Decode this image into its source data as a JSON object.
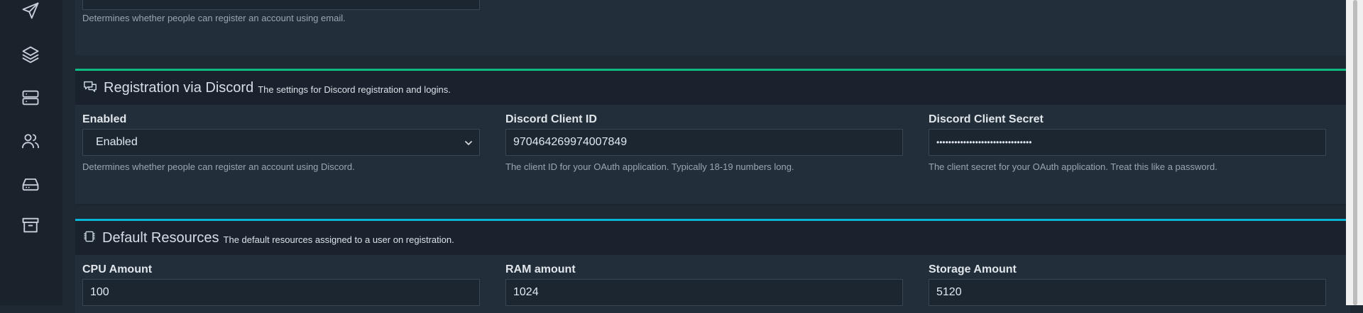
{
  "sidebar": {
    "items": [
      {
        "icon": "send-icon"
      },
      {
        "icon": "layers-icon"
      },
      {
        "icon": "server-icon"
      },
      {
        "icon": "users-icon"
      },
      {
        "icon": "hard-drive-icon"
      },
      {
        "icon": "archive-icon"
      }
    ]
  },
  "email_section": {
    "help": "Determines whether people can register an account using email."
  },
  "discord_section": {
    "accent_color": "#10b981",
    "icon": "chat-icon",
    "title": "Registration via Discord",
    "subtitle": "The settings for Discord registration and logins.",
    "enabled": {
      "label": "Enabled",
      "value": "Enabled",
      "help": "Determines whether people can register an account using Discord."
    },
    "client_id": {
      "label": "Discord Client ID",
      "value": "970464269974007849",
      "help": "The client ID for your OAuth application. Typically 18-19 numbers long."
    },
    "client_secret": {
      "label": "Discord Client Secret",
      "value": "••••••••••••••••••••••••••••••••",
      "help": "The client secret for your OAuth application. Treat this like a password."
    }
  },
  "resources_section": {
    "accent_color": "#06b6d4",
    "icon": "chip-icon",
    "title": "Default Resources",
    "subtitle": "The default resources assigned to a user on registration.",
    "cpu": {
      "label": "CPU Amount",
      "value": "100"
    },
    "ram": {
      "label": "RAM amount",
      "value": "1024"
    },
    "storage": {
      "label": "Storage Amount",
      "value": "5120"
    }
  }
}
